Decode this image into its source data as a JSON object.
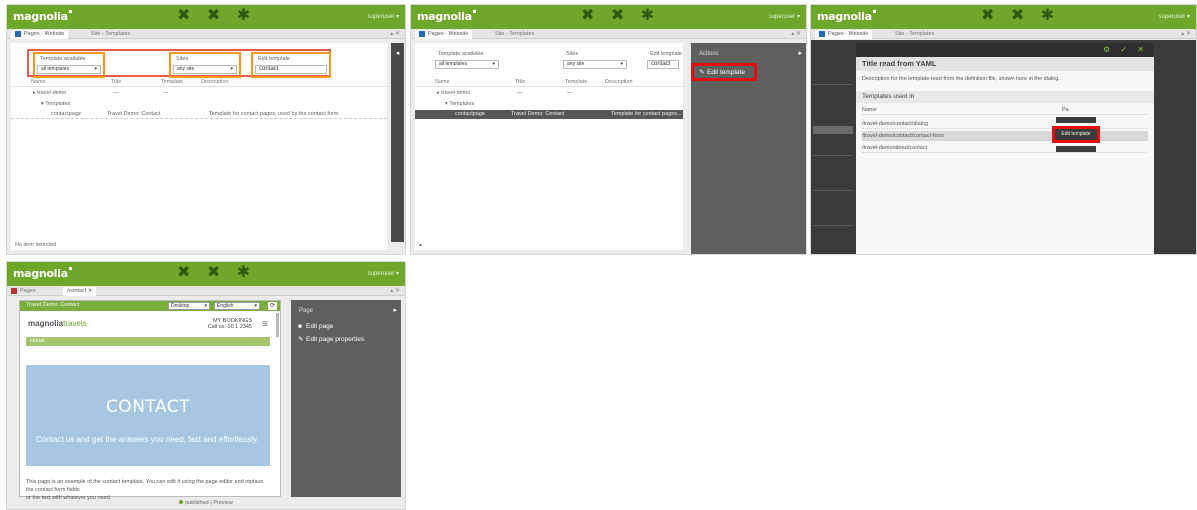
{
  "app": {
    "brand": "magnolia",
    "user": "superuser",
    "apps_icon_glyph": "✖ ✖ ✱"
  },
  "panel1": {
    "tabs": [
      {
        "label": "Pages - Website",
        "icon": "pages-icon",
        "active": true
      },
      {
        "label": "Site - Templates",
        "icon": null,
        "active": false
      }
    ],
    "tab_controls": "▴ ✕",
    "filters": [
      {
        "label": "Template available",
        "value": "all templates"
      },
      {
        "label": "Sites",
        "value": "any site"
      },
      {
        "label": "Edit template",
        "value": "contact"
      }
    ],
    "columns": [
      "Name",
      "Title",
      "Template",
      "Description"
    ],
    "rows": [
      {
        "name": "▸ travel-demo",
        "title": "—",
        "template": "—",
        "desc": ""
      },
      {
        "name": "▾ Templates",
        "title": "",
        "template": "",
        "desc": ""
      },
      {
        "name": "contactpage",
        "title": "Travel Demo: Contact",
        "template": "",
        "desc": "Template for contact pages; used by the contact form."
      }
    ],
    "status": "No item selected"
  },
  "panel2": {
    "tabs": [
      {
        "label": "Pages - Website",
        "icon": "pages-icon",
        "active": true
      },
      {
        "label": "Site - Templates",
        "icon": null,
        "active": false
      }
    ],
    "tab_controls": "▴ ✕",
    "filters": [
      {
        "label": "Template available",
        "value": "all templates"
      },
      {
        "label": "Sites",
        "value": "any site"
      },
      {
        "label": "Edit template",
        "value": "contact"
      }
    ],
    "columns": [
      "Name",
      "Title",
      "Template",
      "Description"
    ],
    "rows": [
      {
        "name": "▸ travel-demo",
        "title": "—",
        "template": "—",
        "desc": ""
      },
      {
        "name": "▾ Templates",
        "title": "",
        "template": "",
        "desc": ""
      },
      {
        "name": "contactpage",
        "title": "Travel Demo: Contact",
        "template": "",
        "desc": "Template for contact pages..."
      }
    ],
    "actionbar": {
      "title": "Actions",
      "edit_item": "Edit template"
    }
  },
  "panel3": {
    "tabs": [
      {
        "label": "Pages - Website",
        "icon": "pages-icon",
        "active": true
      },
      {
        "label": "Site - Templates",
        "icon": null,
        "active": false
      }
    ],
    "tab_controls": "▴ ✕",
    "modal": {
      "controls": "⚙ ✓ ✕",
      "title": "Title read from YAML",
      "description": "Description for the template read from the definition file, shown here in the dialog.",
      "section": "Templates used in",
      "col_name": "Name",
      "col_path": "Pa",
      "rows": [
        {
          "name": "/travel-demo/contact/dialog",
          "action": ""
        },
        {
          "name": "/travel-demo/contact/contact-form",
          "action": "Edit template"
        },
        {
          "name": "/travel-demo/about/contact",
          "action": ""
        }
      ]
    }
  },
  "panel4": {
    "tabs": [
      {
        "label": "Pages",
        "icon": "pages-icon-red",
        "active": false
      },
      {
        "label": "/contact",
        "icon": null,
        "active": true
      }
    ],
    "tab_controls": "▴ ✕",
    "toolbar": {
      "path": "Travel Demo: Contact",
      "device": "Desktop",
      "language": "English",
      "refresh": "⟳"
    },
    "site": {
      "logo_main": "magnolia",
      "logo_sub": "travels",
      "top_link_1": "MY BOOKINGS",
      "top_link_2": "Call us: 00 1 2345",
      "nav": "Home",
      "hero_title": "CONTACT",
      "hero_sub": "Contact us and get the answers you need, fast and effortlessly.",
      "body_line1": "This page is an example of the contact template. You can edit it using the page editor and replace the contact form fields",
      "body_line2": "or the text with whatever you need."
    },
    "actionbar": {
      "title": "Page",
      "items": [
        {
          "icon": "■",
          "label": "Edit page"
        },
        {
          "icon": "✎",
          "label": "Edit page properties"
        }
      ]
    },
    "status": {
      "mode": "published",
      "sep": "|",
      "preview": "Preview"
    }
  }
}
